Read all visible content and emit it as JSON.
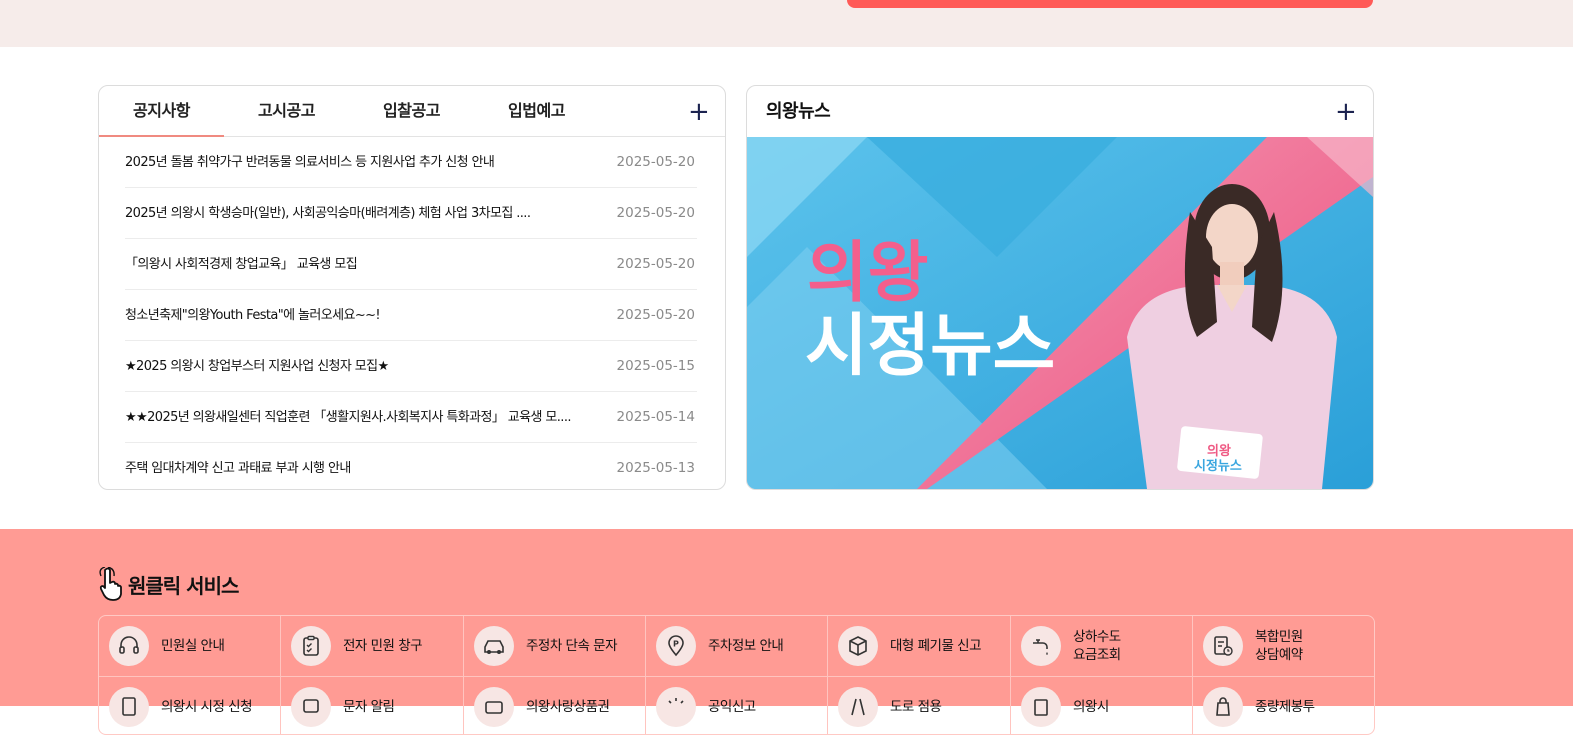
{
  "colors": {
    "accent": "#ff5a57",
    "band": "#ff9b94",
    "top_band": "#f6ecea",
    "tab_underline": "#f08a80"
  },
  "notices": {
    "tabs": [
      {
        "label": "공지사항",
        "active": true
      },
      {
        "label": "고시공고",
        "active": false
      },
      {
        "label": "입찰공고",
        "active": false
      },
      {
        "label": "입법예고",
        "active": false
      }
    ],
    "more_label": "+",
    "items": [
      {
        "title": "2025년 돌봄 취약가구 반려동물 의료서비스 등 지원사업 추가 신청 안내",
        "date": "2025-05-20"
      },
      {
        "title": "2025년 의왕시 학생승마(일반), 사회공익승마(배려계층) 체험 사업 3차모집 ....",
        "date": "2025-05-20"
      },
      {
        "title": "「의왕시 사회적경제 창업교육」 교육생 모집",
        "date": "2025-05-20"
      },
      {
        "title": "청소년축제\"의왕Youth Festa\"에 놀러오세요~~!",
        "date": "2025-05-20"
      },
      {
        "title": "★2025 의왕시 창업부스터 지원사업 신청자 모집★",
        "date": "2025-05-15"
      },
      {
        "title": "★★2025년 의왕새일센터 직업훈련 「생활지원사.사회복지사 특화과정」 교육생 모....",
        "date": "2025-05-14"
      },
      {
        "title": "주택 임대차계약 신고 과태료 부과 시행 안내",
        "date": "2025-05-13"
      }
    ]
  },
  "news": {
    "title": "의왕뉴스",
    "more_label": "+",
    "banner_line1": "의왕",
    "banner_line2": "시정뉴스",
    "card_line1": "의왕",
    "card_line2": "시정뉴스"
  },
  "oneclick": {
    "title": "원클릭 서비스",
    "row1": [
      {
        "label": "민원실 안내",
        "icon": "headset-icon"
      },
      {
        "label": "전자 민원 창구",
        "icon": "clipboard-check-icon"
      },
      {
        "label": "주정차 단속 문자",
        "icon": "car-icon"
      },
      {
        "label": "주차정보 안내",
        "icon": "parking-pin-icon"
      },
      {
        "label": "대형 폐기물 신고",
        "icon": "box-icon"
      },
      {
        "label": "상하수도\n요금조회",
        "icon": "faucet-icon"
      },
      {
        "label": "복합민원\n상담예약",
        "icon": "document-clock-icon"
      }
    ],
    "row2": [
      {
        "label": "의왕시 시정 신청",
        "icon": "document-icon"
      },
      {
        "label": "문자 알림",
        "icon": "message-icon"
      },
      {
        "label": "의왕사랑상품권",
        "icon": "card-icon"
      },
      {
        "label": "공익신고",
        "icon": "siren-icon"
      },
      {
        "label": "도로 점용",
        "icon": "road-icon"
      },
      {
        "label": "의왕시",
        "icon": "building-icon"
      },
      {
        "label": "종량제봉투",
        "icon": "bag-icon"
      }
    ]
  }
}
